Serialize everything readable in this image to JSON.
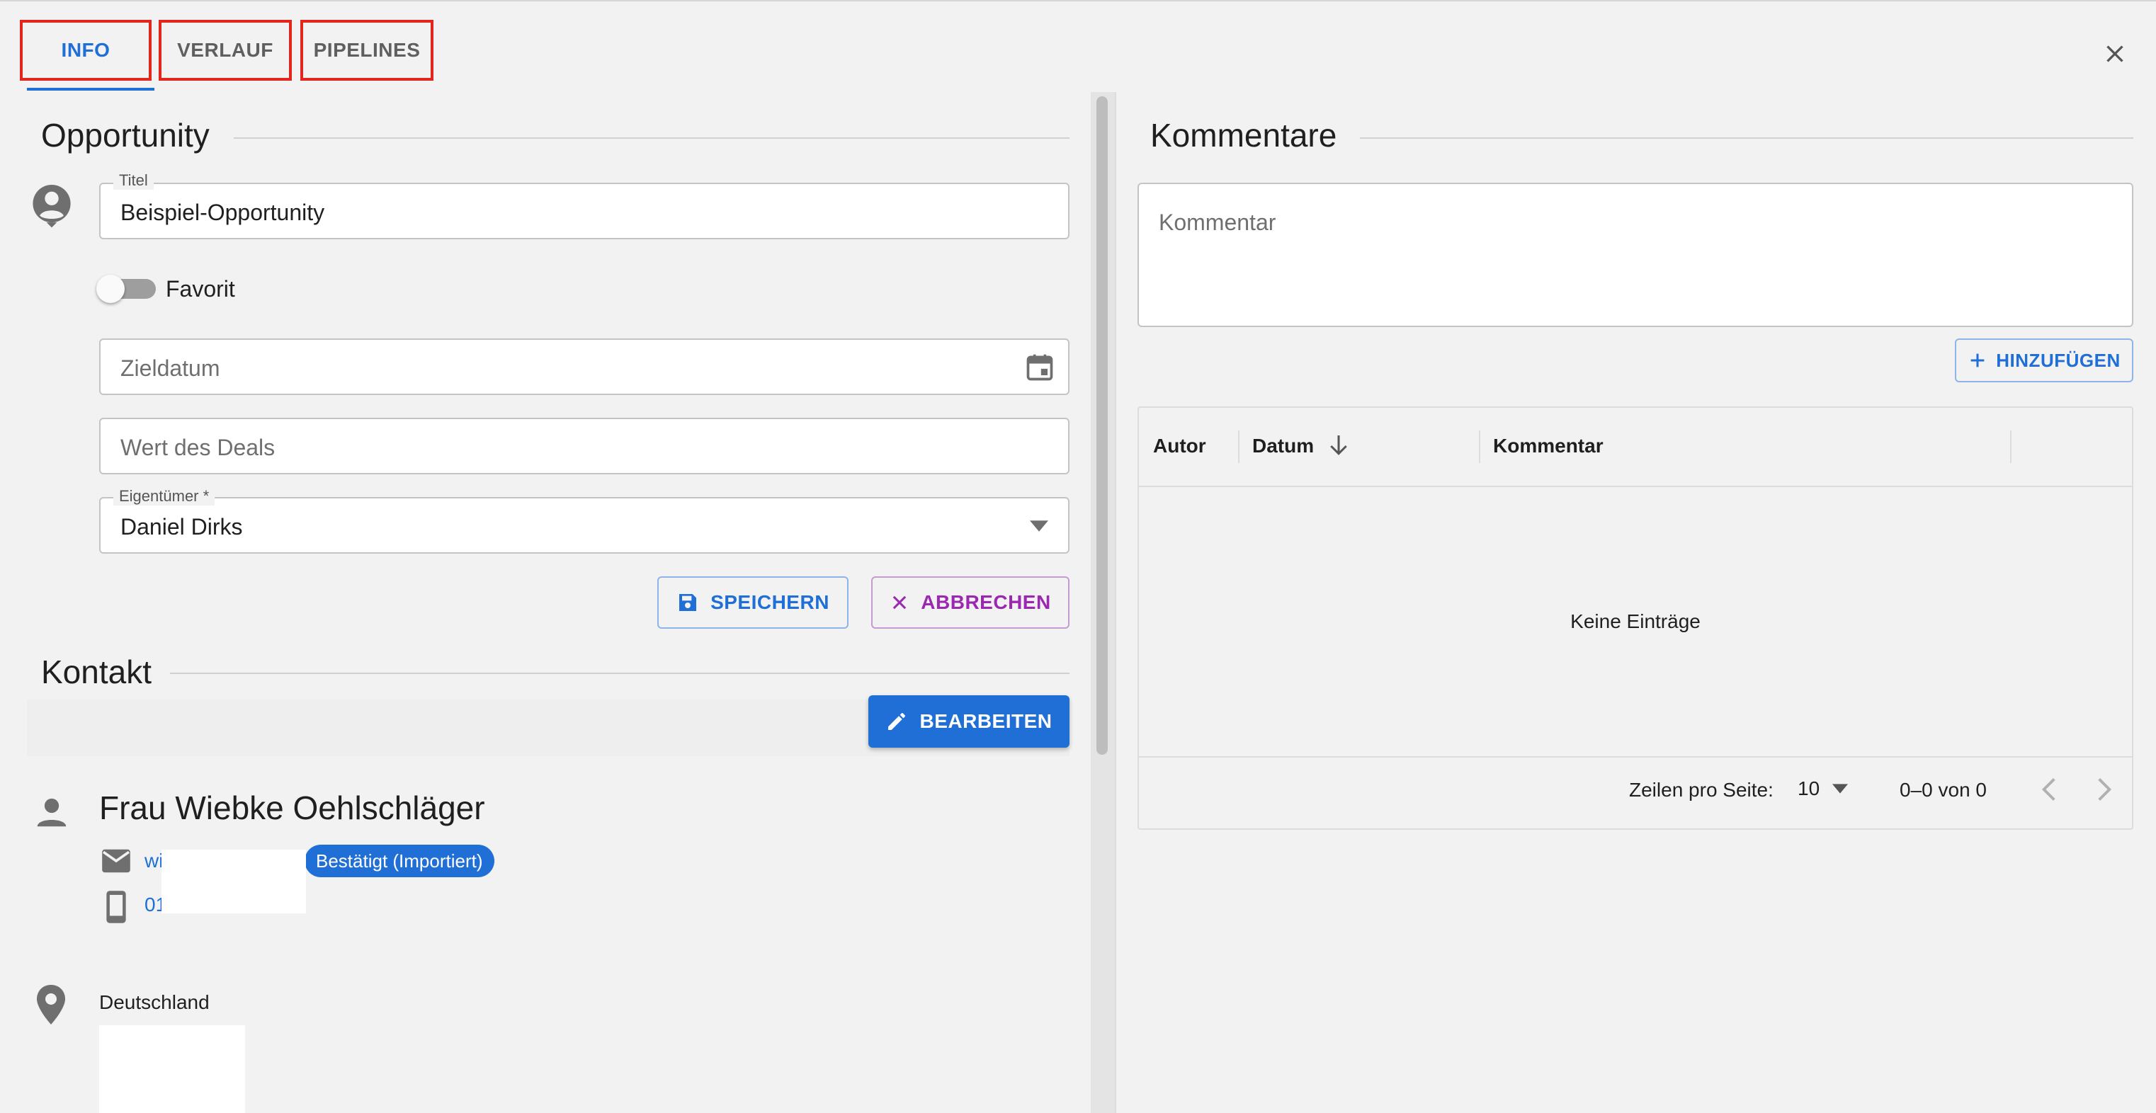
{
  "tabs": [
    {
      "label": "INFO",
      "active": true
    },
    {
      "label": "VERLAUF",
      "active": false
    },
    {
      "label": "PIPELINES",
      "active": false
    }
  ],
  "colors": {
    "accent": "#1f6fd6",
    "highlight_box": "#e2261b",
    "cancel": "#9c27b0"
  },
  "opportunity": {
    "heading": "Opportunity",
    "title_label": "Titel",
    "title_value": "Beispiel-Opportunity",
    "favorite_label": "Favorit",
    "favorite_on": false,
    "target_date_placeholder": "Zieldatum",
    "deal_value_placeholder": "Wert des Deals",
    "owner_label": "Eigentümer *",
    "owner_value": "Daniel Dirks",
    "save_label": "SPEICHERN",
    "cancel_label": "ABBRECHEN"
  },
  "contact": {
    "heading": "Kontakt",
    "edit_label": "BEARBEITEN",
    "name": "Frau Wiebke Oehlschläger",
    "email_partial": "wi",
    "email_badge": "Bestätigt (Importiert)",
    "phone_partial": "01",
    "country": "Deutschland"
  },
  "comments": {
    "heading": "Kommentare",
    "input_placeholder": "Kommentar",
    "add_label": "HINZUFÜGEN",
    "columns": [
      "Autor",
      "Datum",
      "Kommentar"
    ],
    "empty_text": "Keine Einträge",
    "rows_per_page_label": "Zeilen pro Seite:",
    "rows_per_page_value": "10",
    "range_text": "0–0 von 0"
  },
  "icons": [
    "close-icon",
    "account-circle-icon",
    "calendar-icon",
    "dropdown-arrow-icon",
    "save-icon",
    "x-icon",
    "pencil-icon",
    "person-icon",
    "mail-icon",
    "phone-icon",
    "location-pin-icon",
    "plus-icon",
    "sort-down-arrow-icon",
    "chevron-left-icon",
    "chevron-right-icon"
  ]
}
